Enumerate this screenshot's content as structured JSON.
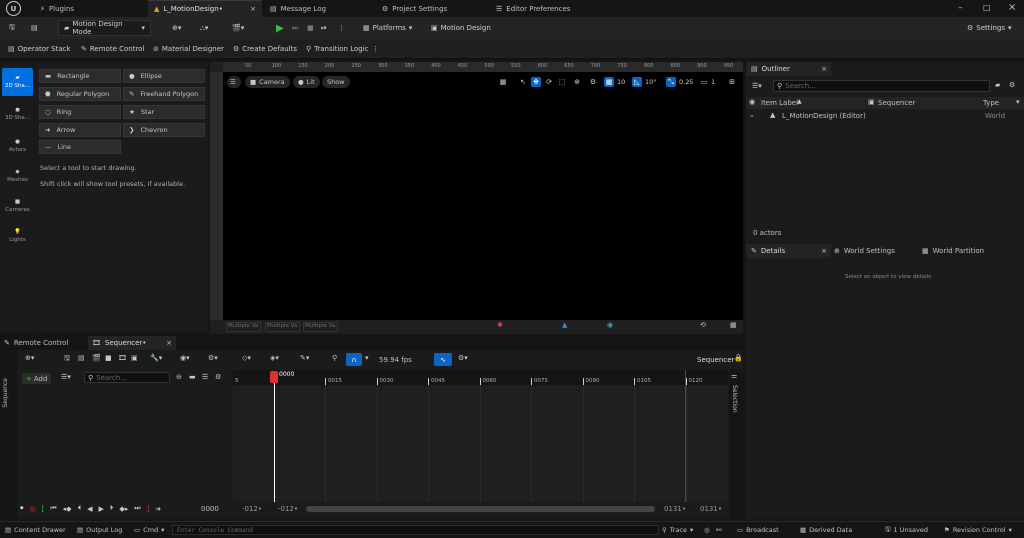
{
  "tabs": [
    {
      "label": "Plugins"
    },
    {
      "label": "L_MotionDesign•"
    },
    {
      "label": "Message Log"
    },
    {
      "label": "Project Settings"
    },
    {
      "label": "Editor Preferences"
    }
  ],
  "toolbar1": {
    "mode_dropdown": "Motion Design Mode",
    "platforms": "Platforms",
    "motion_design": "Motion Design",
    "settings": "Settings"
  },
  "toolbar2": {
    "items": [
      "Operator Stack",
      "Remote Control",
      "Material Designer",
      "Create Defaults",
      "Transition Logic"
    ]
  },
  "modes": [
    "2D Sha...",
    "3D Sha...",
    "Actors",
    "Meshes",
    "Cameras",
    "Lights"
  ],
  "shapes": {
    "items": [
      "Rectangle",
      "Ellipse",
      "Regular Polygon",
      "Freehand Polygon",
      "Ring",
      "Star",
      "Arrow",
      "Chevron",
      "Line"
    ],
    "hint1": "Select a tool to start drawing.",
    "hint2": "Shift click will show tool presets, if available."
  },
  "viewport": {
    "camera": "Camera",
    "lit": "Lit",
    "show": "Show",
    "grid_snap": "10",
    "rot_snap": "10°",
    "scale_snap": "0.25",
    "cam_speed": "1",
    "ruler_top": [
      "50",
      "100",
      "150",
      "200",
      "250",
      "300",
      "350",
      "400",
      "450",
      "500",
      "550",
      "600",
      "650",
      "700",
      "750",
      "800",
      "850",
      "900",
      "950"
    ],
    "bottom_fields": [
      "Multiple Va",
      "Multiple Va",
      "Multiple Va"
    ]
  },
  "outliner": {
    "title": "Outliner",
    "search_placeholder": "Search...",
    "col_label": "Item Label",
    "col_sequencer": "Sequencer",
    "col_type": "Type",
    "row_label": "L_MotionDesign (Editor)",
    "row_type": "World",
    "count": "0 actors"
  },
  "details": {
    "tab_details": "Details",
    "tab_world_settings": "World Settings",
    "tab_world_partition": "World Partition",
    "empty": "Select an object to view details"
  },
  "bottom_tabs": {
    "remote_control": "Remote Control",
    "sequencer": "Sequencer•"
  },
  "sequencer": {
    "fps": "59.94 fps",
    "seq_name": "Sequencer•",
    "add": "Add",
    "search_placeholder": "Search...",
    "current_frame": "0000",
    "ticks": [
      "0015",
      "0030",
      "0045",
      "0060",
      "0075",
      "0090",
      "0105",
      "0120"
    ],
    "left_label": "Sequence",
    "right_label": "Selection",
    "frame_field": "0000",
    "range_start_a": "-012•",
    "range_start_b": "-012•",
    "range_end_a": "0131•",
    "range_end_b": "0131•",
    "start_small": "5"
  },
  "statusbar": {
    "content_drawer": "Content Drawer",
    "output_log": "Output Log",
    "cmd": "Cmd",
    "console_placeholder": "Enter Console Command",
    "trace": "Trace",
    "broadcast": "Broadcast",
    "derived_data": "Derived Data",
    "unsaved": "1 Unsaved",
    "revision_control": "Revision Control"
  }
}
